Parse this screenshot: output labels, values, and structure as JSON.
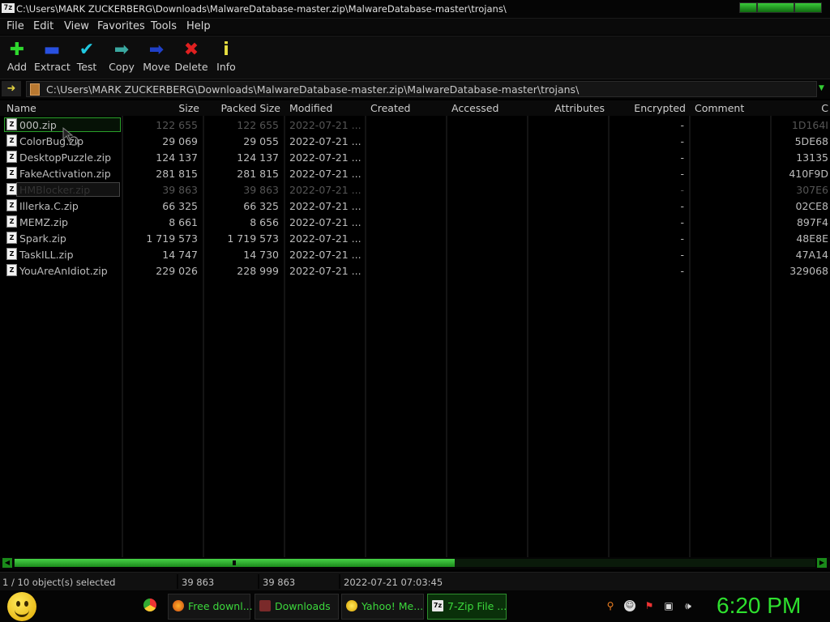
{
  "window": {
    "title": "C:\\Users\\MARK ZUCKERBERG\\Downloads\\MalwareDatabase-master.zip\\MalwareDatabase-master\\trojans\\",
    "icon_label": "7z"
  },
  "menu": [
    "File",
    "Edit",
    "View",
    "Favorites",
    "Tools",
    "Help"
  ],
  "toolbar": {
    "add": "Add",
    "extract": "Extract",
    "test": "Test",
    "copy": "Copy",
    "move": "Move",
    "delete": "Delete",
    "info": "Info"
  },
  "address": {
    "path": "C:\\Users\\MARK ZUCKERBERG\\Downloads\\MalwareDatabase-master.zip\\MalwareDatabase-master\\trojans\\"
  },
  "columns": {
    "name": "Name",
    "size": "Size",
    "packed": "Packed Size",
    "modified": "Modified",
    "created": "Created",
    "accessed": "Accessed",
    "attributes": "Attributes",
    "encrypted": "Encrypted",
    "comment": "Comment",
    "crc": "C"
  },
  "files": [
    {
      "name": "000.zip",
      "size": "122 655",
      "packed": "122 655",
      "modified": "2022-07-21 ...",
      "encrypted": "-",
      "crc": "1D164I",
      "zip_icon": "Z"
    },
    {
      "name": "ColorBug.zip",
      "size": "29 069",
      "packed": "29 055",
      "modified": "2022-07-21 ...",
      "encrypted": "-",
      "crc": "5DE68",
      "zip_icon": "Z"
    },
    {
      "name": "DesktopPuzzle.zip",
      "size": "124 137",
      "packed": "124 137",
      "modified": "2022-07-21 ...",
      "encrypted": "-",
      "crc": "13135",
      "zip_icon": "Z"
    },
    {
      "name": "FakeActivation.zip",
      "size": "281 815",
      "packed": "281 815",
      "modified": "2022-07-21 ...",
      "encrypted": "-",
      "crc": "410F9D",
      "zip_icon": "Z"
    },
    {
      "name": "HMBlocker.zip",
      "size": "39 863",
      "packed": "39 863",
      "modified": "2022-07-21 ...",
      "encrypted": "-",
      "crc": "307E6",
      "zip_icon": "Z"
    },
    {
      "name": "Illerka.C.zip",
      "size": "66 325",
      "packed": "66 325",
      "modified": "2022-07-21 ...",
      "encrypted": "-",
      "crc": "02CE8",
      "zip_icon": "Z"
    },
    {
      "name": "MEMZ.zip",
      "size": "8 661",
      "packed": "8 656",
      "modified": "2022-07-21 ...",
      "encrypted": "-",
      "crc": "897F4",
      "zip_icon": "Z"
    },
    {
      "name": "Spark.zip",
      "size": "1 719 573",
      "packed": "1 719 573",
      "modified": "2022-07-21 ...",
      "encrypted": "-",
      "crc": "48E8E",
      "zip_icon": "Z"
    },
    {
      "name": "TaskILL.zip",
      "size": "14 747",
      "packed": "14 730",
      "modified": "2022-07-21 ...",
      "encrypted": "-",
      "crc": "47A14",
      "zip_icon": "Z"
    },
    {
      "name": "YouAreAnIdiot.zip",
      "size": "229 026",
      "packed": "228 999",
      "modified": "2022-07-21 ...",
      "encrypted": "-",
      "crc": "329068",
      "zip_icon": "Z"
    }
  ],
  "status": {
    "selection": "1 / 10 object(s) selected",
    "size": "39 863",
    "packed": "39 863",
    "modified": "2022-07-21 07:03:45"
  },
  "taskbar": {
    "tasks": [
      {
        "label": "Free downl...",
        "icon": "firefox-icon"
      },
      {
        "label": "Downloads",
        "icon": "folder-icon"
      },
      {
        "label": "Yahoo! Me...",
        "icon": "yahoo-messenger-icon"
      },
      {
        "label": "7-Zip File ...",
        "icon": "7zip-icon",
        "icon_label": "7z"
      }
    ],
    "clock": "6:20 PM"
  },
  "colors": {
    "accent_green": "#2ee02e",
    "background": "#000000"
  }
}
